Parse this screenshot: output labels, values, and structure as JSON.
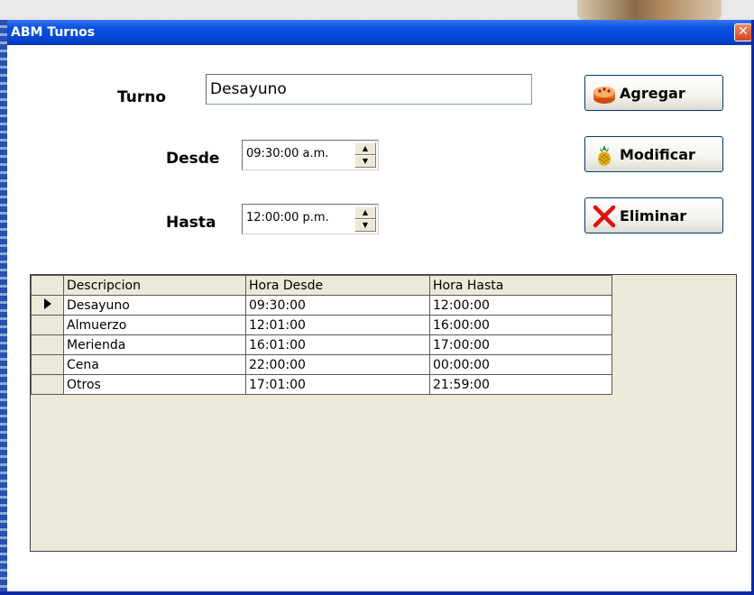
{
  "window": {
    "title": "ABM Turnos"
  },
  "form": {
    "turno_label": "Turno",
    "turno_value": "Desayuno",
    "desde_label": "Desde",
    "desde_value": "09:30:00 a.m.",
    "hasta_label": "Hasta",
    "hasta_value": "12:00:00 p.m."
  },
  "buttons": {
    "agregar": "Agregar",
    "modificar": "Modificar",
    "eliminar": "Eliminar"
  },
  "grid": {
    "columns": [
      "Descripcion",
      "Hora Desde",
      "Hora Hasta"
    ],
    "rows": [
      {
        "descripcion": "Desayuno",
        "desde": "09:30:00",
        "hasta": "12:00:00",
        "selected": true
      },
      {
        "descripcion": "Almuerzo",
        "desde": "12:01:00",
        "hasta": "16:00:00"
      },
      {
        "descripcion": "Merienda",
        "desde": "16:01:00",
        "hasta": "17:00:00"
      },
      {
        "descripcion": "Cena",
        "desde": "22:00:00",
        "hasta": "00:00:00"
      },
      {
        "descripcion": "Otros",
        "desde": "17:01:00",
        "hasta": "21:59:00"
      }
    ]
  },
  "icons": {
    "agregar": "cake-icon",
    "modificar": "pineapple-icon",
    "eliminar": "red-x-icon",
    "close": "close-icon"
  },
  "colors": {
    "titlebar": "#0047d6",
    "close_button": "#d9421f",
    "grid_background": "#ece9d8"
  }
}
